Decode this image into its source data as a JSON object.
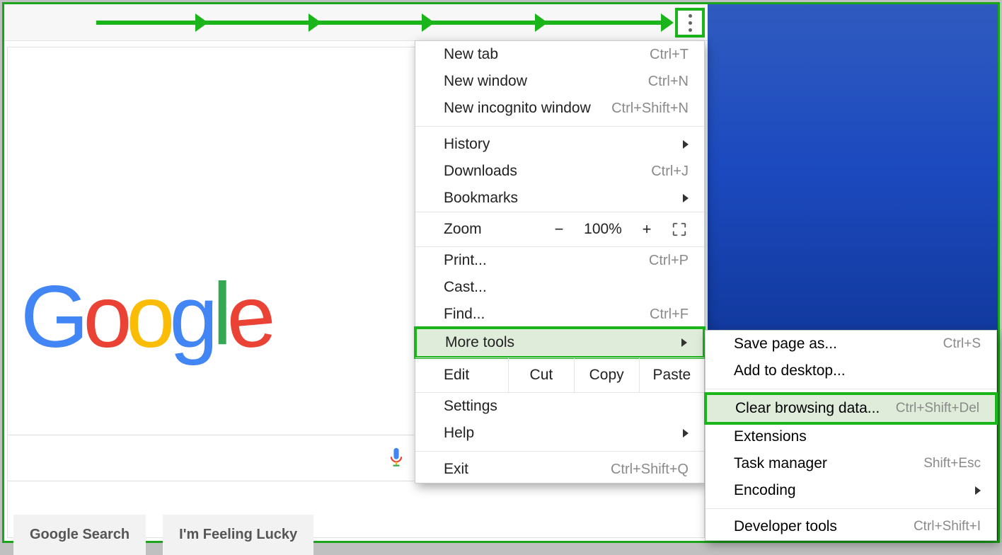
{
  "toolbar": {
    "menu_button_name": "chrome-menu"
  },
  "page": {
    "logo_letters": [
      "G",
      "o",
      "o",
      "g",
      "l",
      "e"
    ],
    "search_placeholder": "",
    "btn_search": "Google Search",
    "btn_lucky": "I'm Feeling Lucky"
  },
  "menu": {
    "new_tab": {
      "label": "New tab",
      "shortcut": "Ctrl+T"
    },
    "new_window": {
      "label": "New window",
      "shortcut": "Ctrl+N"
    },
    "new_incognito": {
      "label": "New incognito window",
      "shortcut": "Ctrl+Shift+N"
    },
    "history": {
      "label": "History"
    },
    "downloads": {
      "label": "Downloads",
      "shortcut": "Ctrl+J"
    },
    "bookmarks": {
      "label": "Bookmarks"
    },
    "zoom": {
      "label": "Zoom",
      "value": "100%",
      "minus": "−",
      "plus": "+"
    },
    "print": {
      "label": "Print...",
      "shortcut": "Ctrl+P"
    },
    "cast": {
      "label": "Cast..."
    },
    "find": {
      "label": "Find...",
      "shortcut": "Ctrl+F"
    },
    "more_tools": {
      "label": "More tools"
    },
    "edit": {
      "label": "Edit",
      "cut": "Cut",
      "copy": "Copy",
      "paste": "Paste"
    },
    "settings": {
      "label": "Settings"
    },
    "help": {
      "label": "Help"
    },
    "exit": {
      "label": "Exit",
      "shortcut": "Ctrl+Shift+Q"
    }
  },
  "submenu": {
    "save_page": {
      "label": "Save page as...",
      "shortcut": "Ctrl+S"
    },
    "add_desktop": {
      "label": "Add to desktop..."
    },
    "clear_data": {
      "label": "Clear browsing data...",
      "shortcut": "Ctrl+Shift+Del"
    },
    "extensions": {
      "label": "Extensions"
    },
    "task_manager": {
      "label": "Task manager",
      "shortcut": "Shift+Esc"
    },
    "encoding": {
      "label": "Encoding"
    },
    "dev_tools": {
      "label": "Developer tools",
      "shortcut": "Ctrl+Shift+I"
    }
  },
  "annotation": {
    "arrow_color": "#1ab51a",
    "highlight_color": "#1ab51a"
  }
}
